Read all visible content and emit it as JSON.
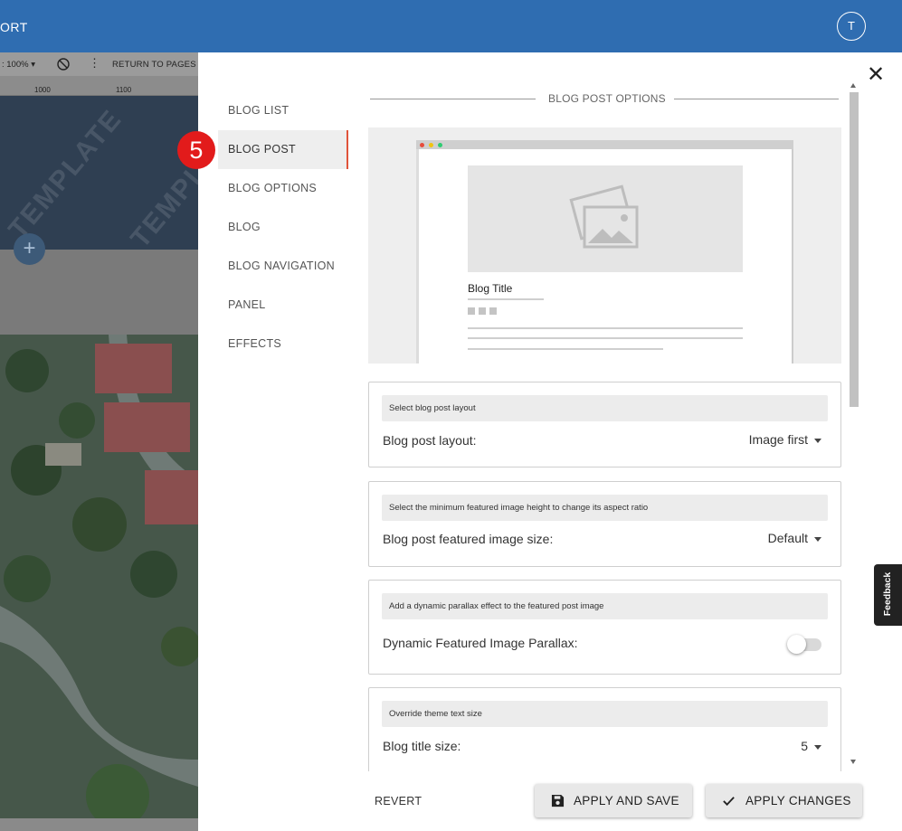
{
  "topbar": {
    "app_label": "ORT",
    "avatar_initial": "T"
  },
  "editor": {
    "zoom": ": 100% ▾",
    "more": "⋮",
    "return_label": "RETURN TO PAGES",
    "ruler_ticks": [
      "1000",
      "1100"
    ],
    "watermark": "TEMPLATE",
    "add": "+"
  },
  "panel": {
    "nav": [
      {
        "label": "BLOG LIST"
      },
      {
        "label": "BLOG POST"
      },
      {
        "label": "BLOG OPTIONS"
      },
      {
        "label": "BLOG"
      },
      {
        "label": "BLOG NAVIGATION"
      },
      {
        "label": "PANEL"
      },
      {
        "label": "EFFECTS"
      }
    ],
    "step_badge": "5",
    "close": "✕",
    "section_title": "BLOG POST OPTIONS",
    "preview": {
      "blog_title": "Blog Title",
      "dot_colors": [
        "#e74c3c",
        "#f1c40f",
        "#2ecc71"
      ]
    },
    "settings": [
      {
        "hint": "Select blog post layout",
        "label": "Blog post layout:",
        "value": "Image first"
      },
      {
        "hint": "Select the minimum featured image height to change its aspect ratio",
        "label": "Blog post featured image size:",
        "value": "Default"
      },
      {
        "hint": "Add a dynamic parallax effect to the featured post image",
        "label": "Dynamic Featured Image Parallax:",
        "toggle_on": false
      },
      {
        "hint": "Override theme text size",
        "label": "Blog title size:",
        "value": "5"
      }
    ],
    "footer": {
      "revert": "REVERT",
      "apply_save": "APPLY AND SAVE",
      "apply_changes": "APPLY CHANGES"
    }
  },
  "feedback_label": "Feedback",
  "colors": {
    "topbar": "#2f6db1",
    "active_accent": "#e0533a",
    "badge": "#e21b1b"
  }
}
